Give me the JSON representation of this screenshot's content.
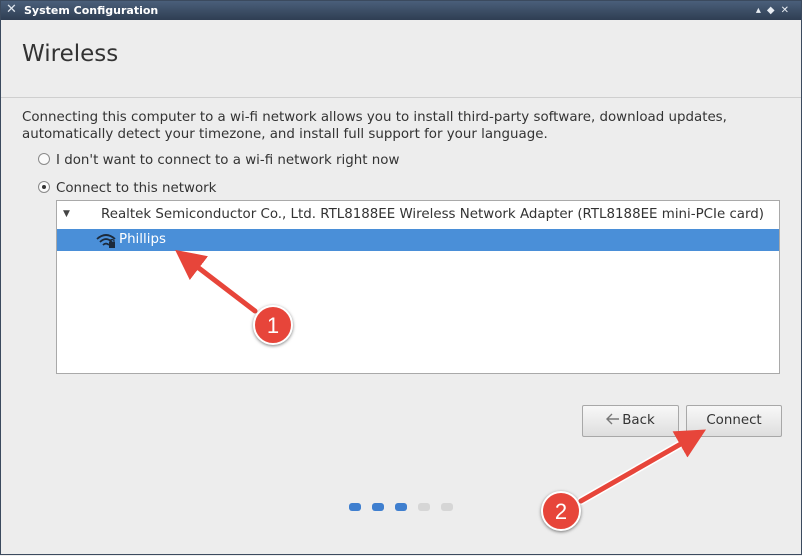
{
  "window": {
    "title": "System Configuration",
    "controls": [
      "▴",
      "◆",
      "✕"
    ]
  },
  "page": {
    "title": "Wireless"
  },
  "description": "Connecting this computer to a wi-fi network allows you to install third-party software, download updates, automatically detect your timezone, and install full support for your language.",
  "options": [
    {
      "label": "I don't want to connect to a wi-fi network right now",
      "selected": false
    },
    {
      "label": "Connect to this network",
      "selected": true
    }
  ],
  "network_list": {
    "adapter": "Realtek Semiconductor Co., Ltd. RTL8188EE Wireless Network Adapter (RTL8188EE mini-PCIe card)",
    "networks": [
      {
        "name": "Phillips",
        "selected": true,
        "icon": "wifi-lock-icon"
      }
    ]
  },
  "buttons": {
    "back": "Back",
    "connect": "Connect"
  },
  "progress": {
    "total_steps": 5,
    "current_step": 3,
    "active_color": "#3f7fcf",
    "inactive_color": "#d6d6d6"
  },
  "callouts": [
    {
      "number": "1"
    },
    {
      "number": "2"
    }
  ],
  "colors": {
    "selection": "#4a8fd8",
    "callout": "#e7453a",
    "titlebar": "#3b4b62"
  }
}
